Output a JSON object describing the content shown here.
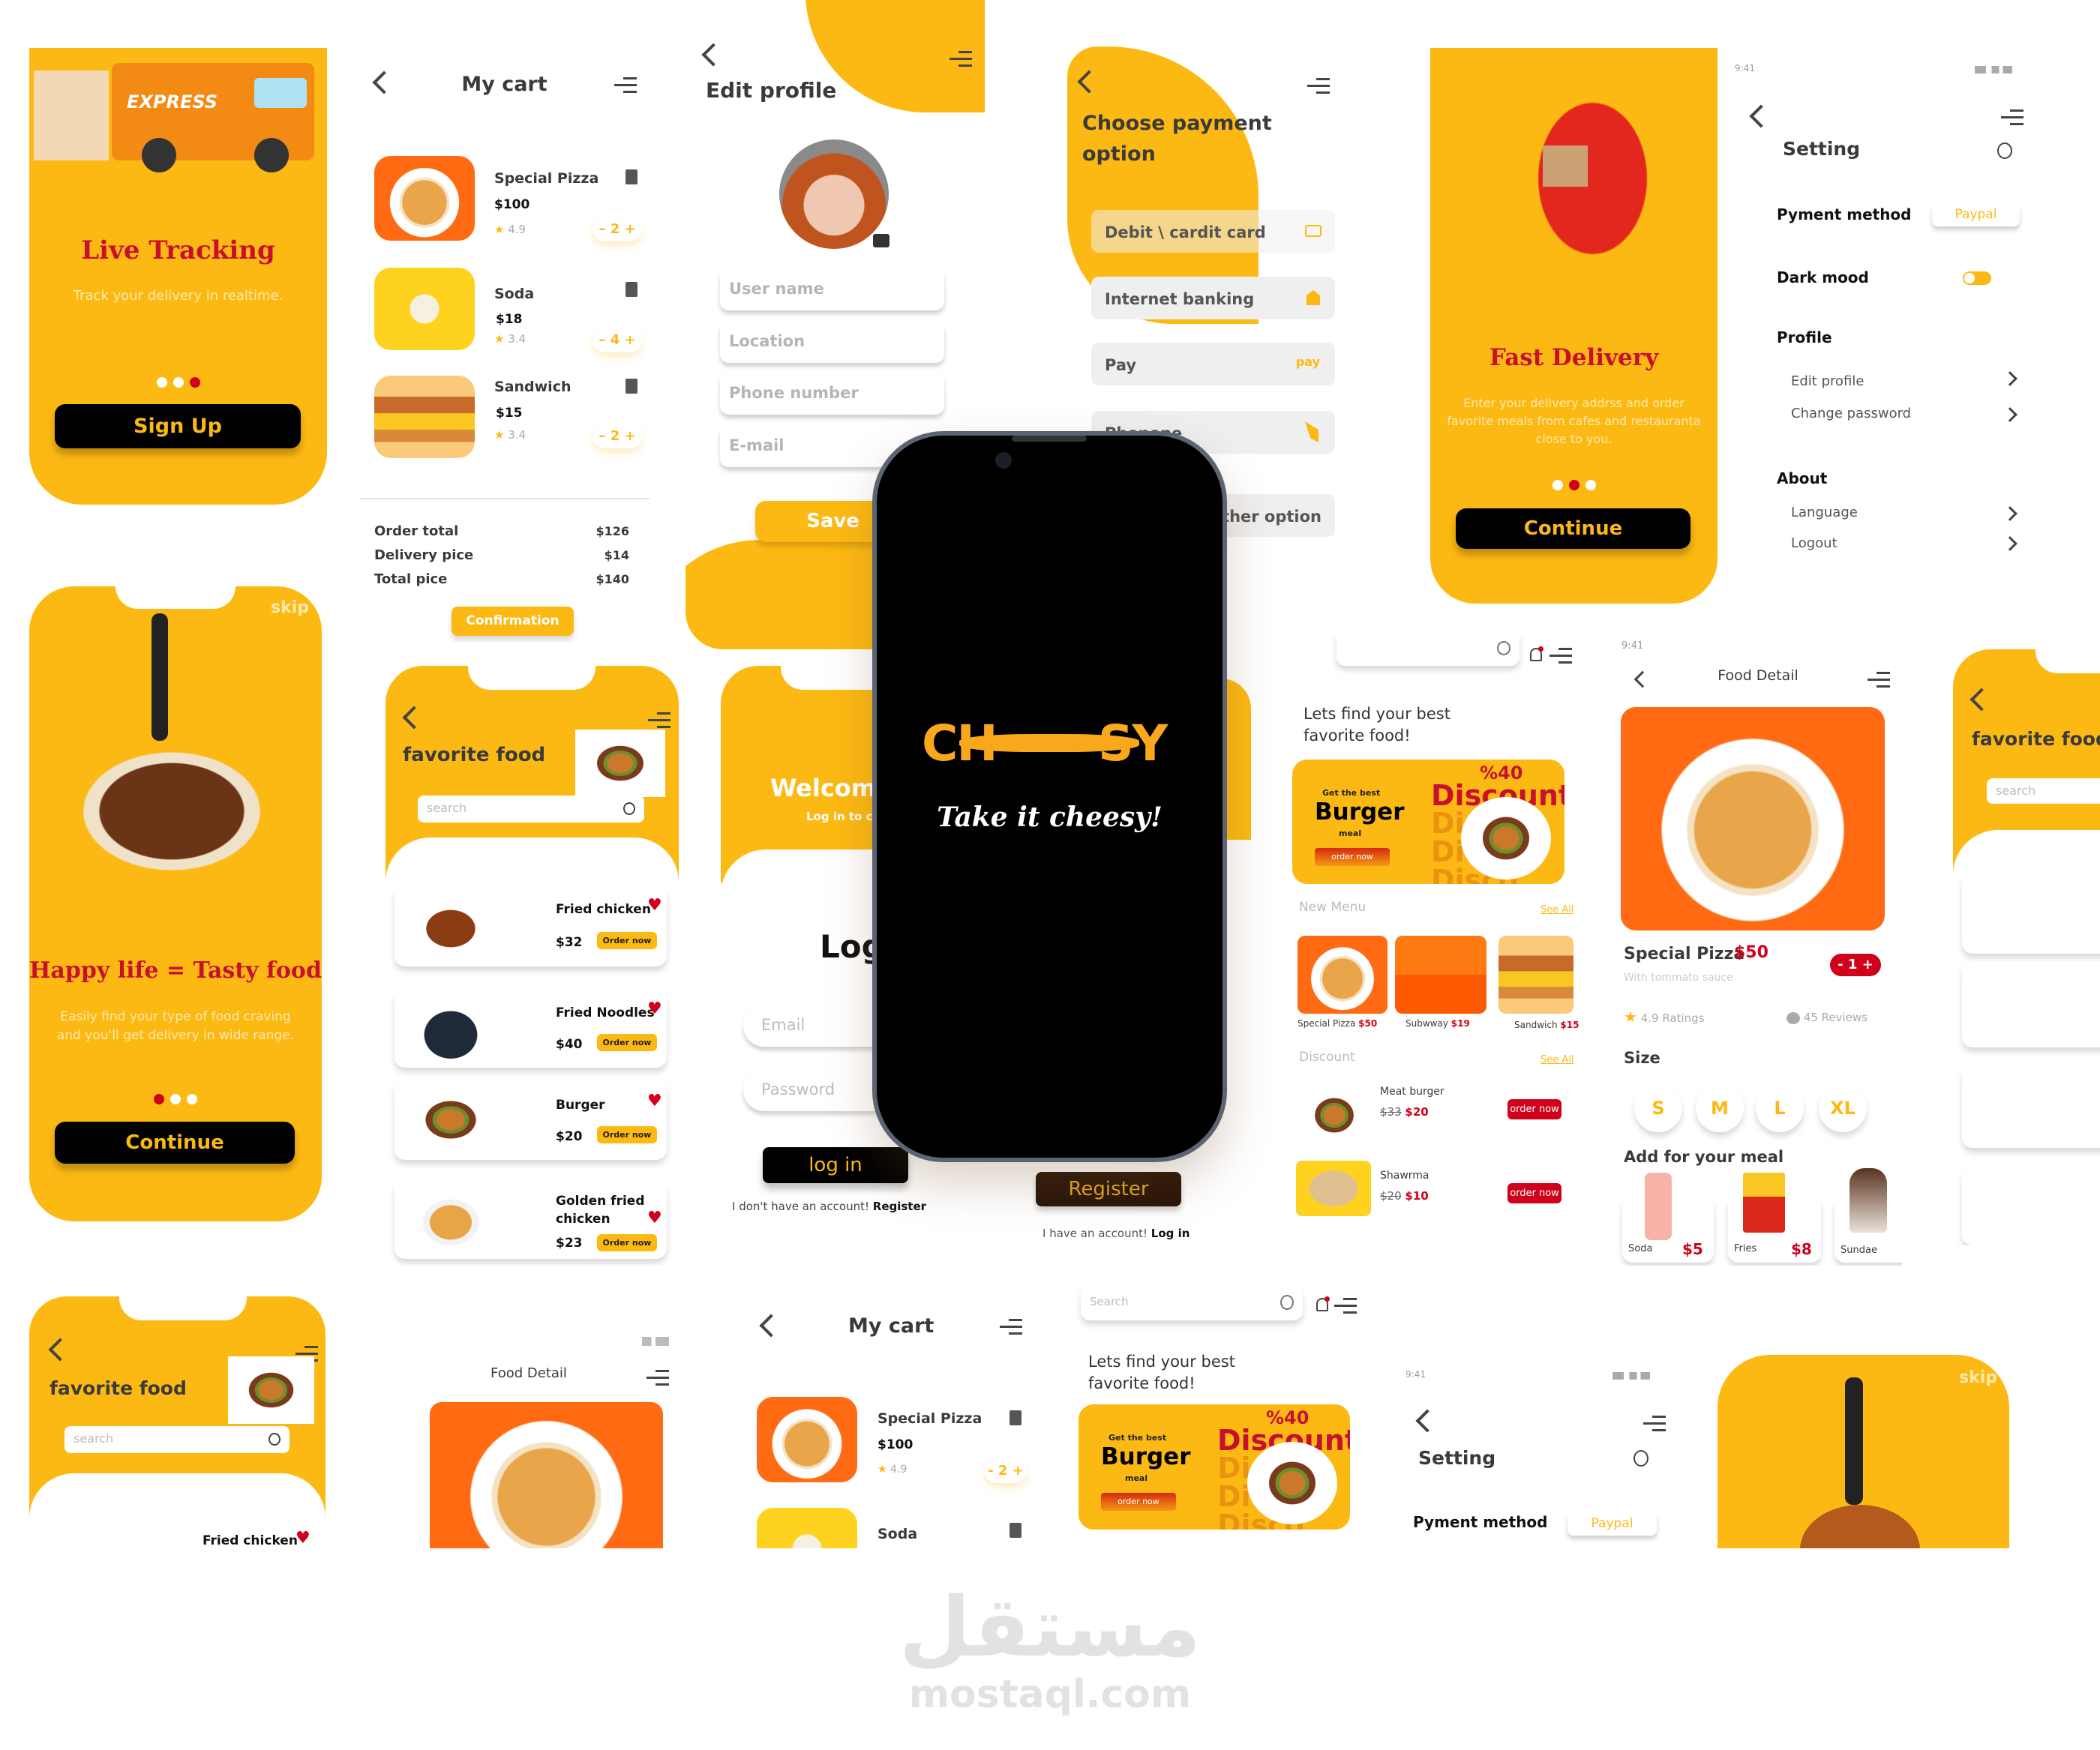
{
  "colors": {
    "brand_yellow": "#FDB913",
    "accent_red": "#D0021B",
    "dark": "#000000"
  },
  "live_tracking": {
    "truck_label": "EXPRESS",
    "title": "Live Tracking",
    "subtitle": "Track your delivery in realtime.",
    "button": "Sign Up",
    "active_dot": 3
  },
  "cart": {
    "title": "My cart",
    "items": [
      {
        "name": "Special Pizza",
        "price": "$100",
        "rating": "4.9",
        "qty": "2"
      },
      {
        "name": "Soda",
        "price": "$18",
        "rating": "3.4",
        "qty": "4"
      },
      {
        "name": "Sandwich",
        "price": "$15",
        "rating": "3.4",
        "qty": "2"
      }
    ],
    "summary": [
      {
        "label": "Order total",
        "value": "$126"
      },
      {
        "label": "Delivery pice",
        "value": "$14"
      },
      {
        "label": "Total pice",
        "value": "$140"
      }
    ],
    "confirm": "Confirmation"
  },
  "edit_profile": {
    "title": "Edit profile",
    "fields": [
      "User name",
      "Location",
      "Phone number",
      "E-mail"
    ],
    "save": "Save"
  },
  "payment": {
    "title_line1": "Choose payment",
    "title_line2": "option",
    "options": [
      "Debit \\ cardit card",
      "Internet banking",
      "Pay",
      "Phonepe",
      "Other option"
    ]
  },
  "fast_delivery": {
    "title": "Fast Delivery",
    "desc": "Enter your delivery addrss and order favorite meals from cafes and restauranta close to you.",
    "button": "Continue",
    "active_dot": 2
  },
  "setting": {
    "time": "9:41",
    "title": "Setting",
    "payment_label": "Pyment method",
    "payment_value": "Paypal",
    "dark_label": "Dark mood",
    "dark_mode_on": false,
    "profile_heading": "Profile",
    "profile_items": [
      "Edit profile",
      "Change password"
    ],
    "about_heading": "About",
    "about_items": [
      "Language",
      "Logout"
    ]
  },
  "happy": {
    "skip": "skip",
    "title": "Happy life = Tasty food",
    "desc": "Easily find your type of food craving and you'll get delivery in wide range.",
    "button": "Continue",
    "active_dot": 1
  },
  "favorites": {
    "title": "favorite food",
    "search_placeholder": "search",
    "order_label": "Order now",
    "items": [
      {
        "name": "Fried chicken",
        "price": "$32"
      },
      {
        "name": "Fried Noodles",
        "price": "$40"
      },
      {
        "name": "Burger",
        "price": "$20"
      },
      {
        "name": "Golden fried chicken",
        "price": "$23"
      }
    ]
  },
  "login": {
    "welcome": "Welcome",
    "subtitle": "Log in to continue",
    "heading": "Login",
    "email": "Email",
    "password": "Password",
    "button": "log in",
    "no_account": "I don't have an account!",
    "register_link": "Register"
  },
  "register": {
    "button": "Register",
    "have_account": "I have an account!",
    "login_link": "Log in"
  },
  "splash": {
    "logo": "CHEESY",
    "tagline": "Take it cheesy!"
  },
  "home": {
    "search_placeholder": "Search",
    "greeting_line1": "Lets find your best",
    "greeting_line2": "favorite food!",
    "banner": {
      "small": "Get the best",
      "big": "Burger",
      "meal": "meal",
      "cta": "order now",
      "percent": "%40",
      "discount": "Discount"
    },
    "new_menu": "New Menu",
    "see_all": "See All",
    "menu": [
      {
        "name": "Special Pizza",
        "price": "$50"
      },
      {
        "name": "Subwway",
        "price": "$19"
      },
      {
        "name": "Sandwich",
        "price": "$15"
      }
    ],
    "discount_heading": "Discount",
    "deals": [
      {
        "name": "Meat burger",
        "old": "$33",
        "new": "$20"
      },
      {
        "name": "Shawrma",
        "old": "$20",
        "new": "$10"
      }
    ],
    "order_now": "order now"
  },
  "food_detail": {
    "time": "9:41",
    "title": "Food Detail",
    "name": "Special Pizza",
    "price": "$50",
    "sub": "With tommato sauce",
    "qty": "1",
    "ratings": "4.9 Ratings",
    "reviews": "45 Reviews",
    "size_label": "Size",
    "sizes": [
      "S",
      "M",
      "L",
      "XL"
    ],
    "addons_label": "Add for your meal",
    "addons": [
      {
        "name": "Soda",
        "price": "$5"
      },
      {
        "name": "Fries",
        "price": "$8"
      },
      {
        "name": "Sundae"
      }
    ]
  },
  "watermark": {
    "arabic": "مستقل",
    "latin": "mostaql.com"
  }
}
